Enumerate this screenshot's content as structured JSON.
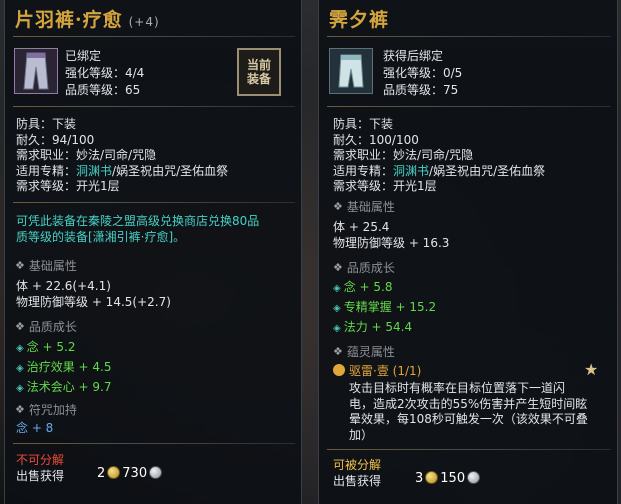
{
  "left": {
    "title": "片羽裤·疗愈",
    "title_suffix": "(+4)",
    "bind_status": "已绑定",
    "enhance": "强化等级：4/4",
    "quality": "品质等级：65",
    "stamp": "当前装备",
    "armor": "防具：下装",
    "durability": "耐久：94/100",
    "classes": "需求职业：妙法/司命/咒隐",
    "spec_prefix": "适用专精：",
    "spec_value": "洞渊书",
    "spec_rest": "/娲圣祝由咒/圣佑血祭",
    "req_level": "需求等级：开光1层",
    "exchange_line1": "可凭此装备在秦陵之盟高级兑换商店兑换80品",
    "exchange_line2": "质等级的装备[潇湘引裤·疗愈]。",
    "base_header": "基础属性",
    "base_attr1": "体 + 22.6(+4.1)",
    "base_attr2": "物理防御等级 + 14.5(+2.7)",
    "quality_header": "品质成长",
    "q_attr1": "念 + 5.2",
    "q_attr2": "治疗效果 + 4.5",
    "q_attr3": "法术会心 + 9.7",
    "rune_header": "符咒加持",
    "rune_attr": "念 + 8",
    "no_split": "不可分解",
    "sell_label": "出售获得",
    "sell_gold": "2",
    "sell_silver": "730"
  },
  "right": {
    "title": "霁夕裤",
    "bind_status": "获得后绑定",
    "enhance": "强化等级：0/5",
    "quality": "品质等级：75",
    "armor": "防具：下装",
    "durability": "耐久：100/100",
    "classes": "需求职业：妙法/司命/咒隐",
    "spec_prefix": "适用专精：",
    "spec_value": "洞渊书",
    "spec_rest": "/娲圣祝由咒/圣佑血祭",
    "req_level": "需求等级：开光1层",
    "base_header": "基础属性",
    "base_attr1": "体 + 25.4",
    "base_attr2": "物理防御等级 + 16.3",
    "quality_header": "品质成长",
    "q_attr1": "念 + 5.8",
    "q_attr2": "专精掌握 + 15.2",
    "q_attr3": "法力 + 54.4",
    "spirit_header": "蕴灵属性",
    "spirit_name": "驱雷·壹",
    "spirit_count": "(1/1)",
    "spirit_desc1": "攻击目标时有概率在目标位置落下一道闪",
    "spirit_desc2": "电，造成2次攻击的55%伤害并产生短时间眩",
    "spirit_desc3": "晕效果，每108秒可触发一次（该效果不可叠",
    "spirit_desc4": "加）",
    "can_split": "可被分解",
    "sell_label": "出售获得",
    "sell_gold": "3",
    "sell_silver": "150"
  },
  "colors": {
    "title": "#d4a53e",
    "cyan": "#47d1c6",
    "green": "#62d94c",
    "blue": "#6aa8f0",
    "red": "#f04a3a"
  }
}
